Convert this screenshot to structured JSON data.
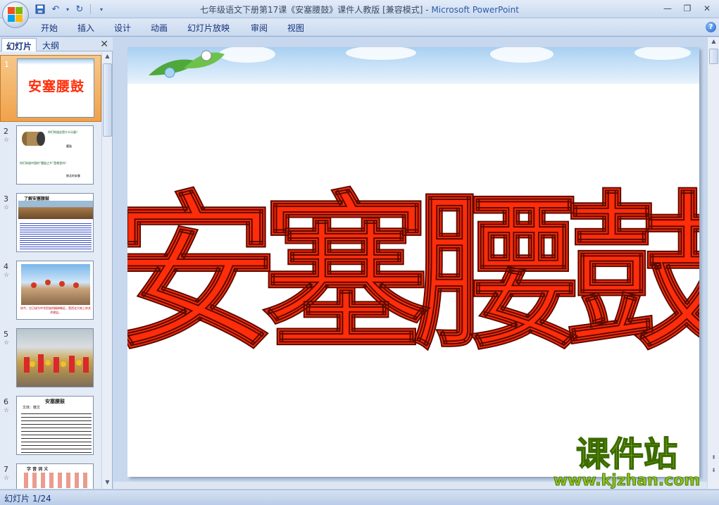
{
  "window": {
    "title_doc": "七年级语文下册第17课《安塞腰鼓》课件人教版 [兼容模式]",
    "title_sep": " - ",
    "title_app": "Microsoft PowerPoint"
  },
  "ribbon": {
    "tabs": [
      "开始",
      "插入",
      "设计",
      "动画",
      "幻灯片放映",
      "审阅",
      "视图"
    ]
  },
  "panel": {
    "tab_slides": "幻灯片",
    "tab_outline": "大纲",
    "thumbnails": [
      {
        "num": "1",
        "title": "安塞腰鼓"
      },
      {
        "num": "2",
        "q1": "你们知道这是什么乐器？",
        "a1": "腰鼓",
        "q2": "你们知道中国的“腰鼓之乡”是哪里吗？",
        "a2": "陕北的安塞"
      },
      {
        "num": "3",
        "heading": "了解安塞腰鼓"
      },
      {
        "num": "4",
        "caption": "如今，它已成为中华民族的精神象征，是西北大地上的艺术瑰宝。"
      },
      {
        "num": "5"
      },
      {
        "num": "6",
        "heading": "安塞腰鼓",
        "sub": "文体：散文"
      },
      {
        "num": "7",
        "heading": "字 音 词 义"
      }
    ]
  },
  "slide": {
    "title": "安塞腰鼓"
  },
  "watermark": {
    "cn": "课件站",
    "url": "www.kjzhan.com"
  },
  "status": {
    "text": "幻灯片 1/24"
  },
  "colors": {
    "title_red": "#ff2d0a",
    "ribbon_blue": "#c9d9ef",
    "watermark_green": "#8fc21d"
  }
}
